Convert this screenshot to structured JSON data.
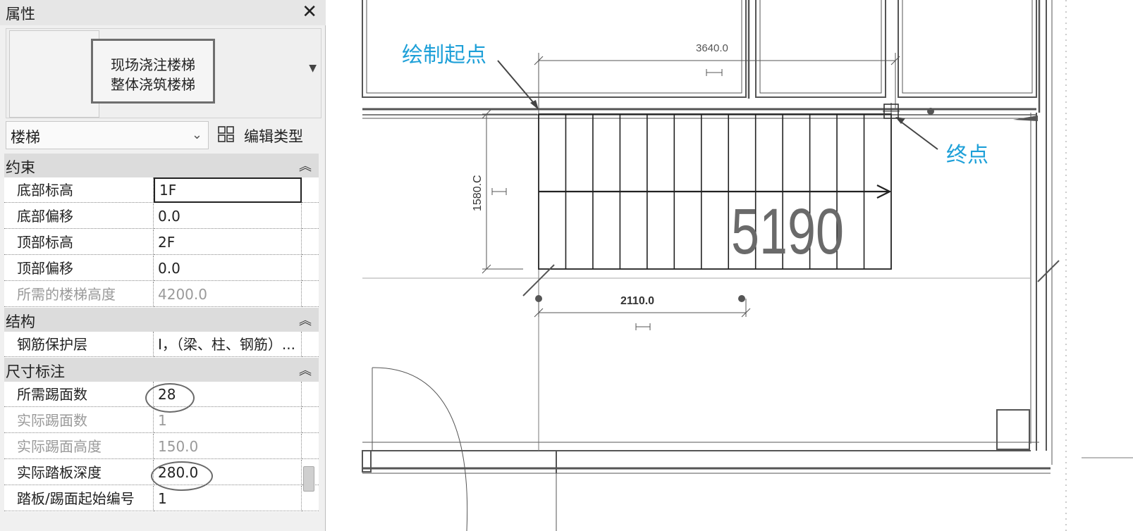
{
  "panel": {
    "title": "属性",
    "close_icon": "close-icon",
    "type_name_line1": "现场浇注楼梯",
    "type_name_line2": "整体浇筑楼梯",
    "type_selector_value": "楼梯",
    "edit_type_label": "编辑类型"
  },
  "categories": {
    "constraints": "约束",
    "structure": "结构",
    "dimensions": "尺寸标注"
  },
  "constraints": [
    {
      "name": "底部标高",
      "value": "1F"
    },
    {
      "name": "底部偏移",
      "value": "0.0"
    },
    {
      "name": "顶部标高",
      "value": "2F"
    },
    {
      "name": "顶部偏移",
      "value": "0.0"
    },
    {
      "name": "所需的楼梯高度",
      "value": "4200.0"
    }
  ],
  "structure": [
    {
      "name": "钢筋保护层",
      "value": "I，（梁、柱、钢筋）..."
    }
  ],
  "dimensions": [
    {
      "name": "所需踢面数",
      "value": "28"
    },
    {
      "name": "实际踢面数",
      "value": "1"
    },
    {
      "name": "实际踢面高度",
      "value": "150.0"
    },
    {
      "name": "实际踏板深度",
      "value": "280.0"
    },
    {
      "name": "踏板/踢面起始编号",
      "value": "1"
    }
  ],
  "drawing": {
    "start_label": "绘制起点",
    "end_label": "终点",
    "dim_top": "3640.0",
    "dim_left": "1580.C",
    "dim_bottom": "2110.0",
    "big_number": "5190",
    "annotation_color": "#1ea0d8"
  }
}
